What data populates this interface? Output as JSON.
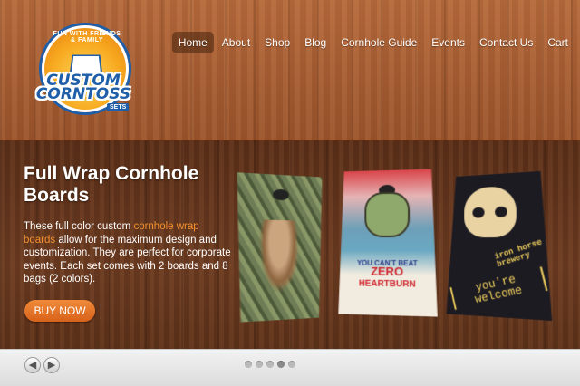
{
  "logo": {
    "ring_text": "FUN WITH FRIENDS & FAMILY",
    "name_line1": "CUSTOM",
    "name_line2": "CORNTOSS",
    "sets": "SETS"
  },
  "nav": {
    "items": [
      {
        "label": "Home",
        "active": true
      },
      {
        "label": "About"
      },
      {
        "label": "Shop"
      },
      {
        "label": "Blog"
      },
      {
        "label": "Cornhole Guide"
      },
      {
        "label": "Events"
      },
      {
        "label": "Contact Us"
      },
      {
        "label": "Cart"
      }
    ]
  },
  "slide": {
    "title": "Full Wrap Cornhole Boards",
    "desc_before": "These full color custom ",
    "desc_link": "cornhole wrap boards",
    "desc_after": " allow for the maximum design and customization. They are perfect for corporate events. Each set comes with 2 boards and 8 bags (2 colors).",
    "button": "BUY NOW"
  },
  "boards": {
    "board2_line1": "YOU CAN'T BEAT",
    "board2_line2": "ZERO",
    "board2_line3": "HEARTBURN",
    "board3_line1": "iron horse brewery",
    "board3_line2": "you're welcome"
  },
  "controls": {
    "prev_icon": "◀",
    "next_icon": "▶",
    "dots": [
      false,
      false,
      false,
      true,
      false
    ]
  },
  "colors": {
    "accent": "#f08a3a",
    "link": "#f3902e",
    "logo_blue": "#1f5ea8"
  }
}
